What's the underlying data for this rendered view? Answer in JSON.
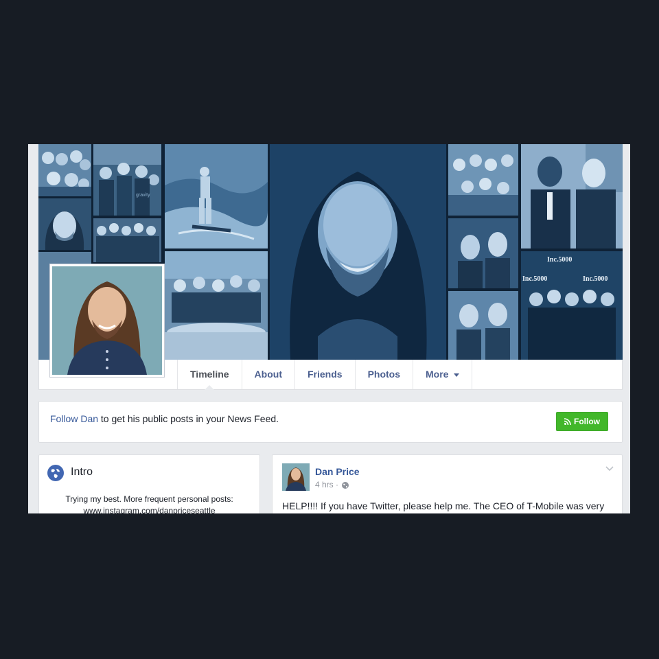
{
  "profile": {
    "name": "Dan Price"
  },
  "cover": {
    "badges": [
      "Inc.5000",
      "Inc.5000",
      "Inc.5000"
    ]
  },
  "nav": {
    "tabs": [
      "Timeline",
      "About",
      "Friends",
      "Photos",
      "More"
    ],
    "active": "Timeline"
  },
  "follow_banner": {
    "link_text": "Follow Dan",
    "rest_text": " to get his public posts in your News Feed.",
    "button_label": "Follow"
  },
  "intro": {
    "title": "Intro",
    "bio_line1": "Trying my best. More frequent personal posts:",
    "bio_line2": "www.instagram.com/danpriceseattle"
  },
  "post": {
    "author": "Dan Price",
    "time": "4 hrs",
    "separator": " · ",
    "text": "HELP!!!! If you have Twitter, please help me. The CEO of T-Mobile was very"
  },
  "colors": {
    "page_bg": "#171c24",
    "link": "#365899",
    "follow_green": "#42b72a",
    "cover_tint": "#1f4a73"
  },
  "icons": {
    "intro": "globe-icon",
    "follow": "rss-icon",
    "privacy": "globe-icon",
    "post_menu": "chevron-down-icon"
  }
}
